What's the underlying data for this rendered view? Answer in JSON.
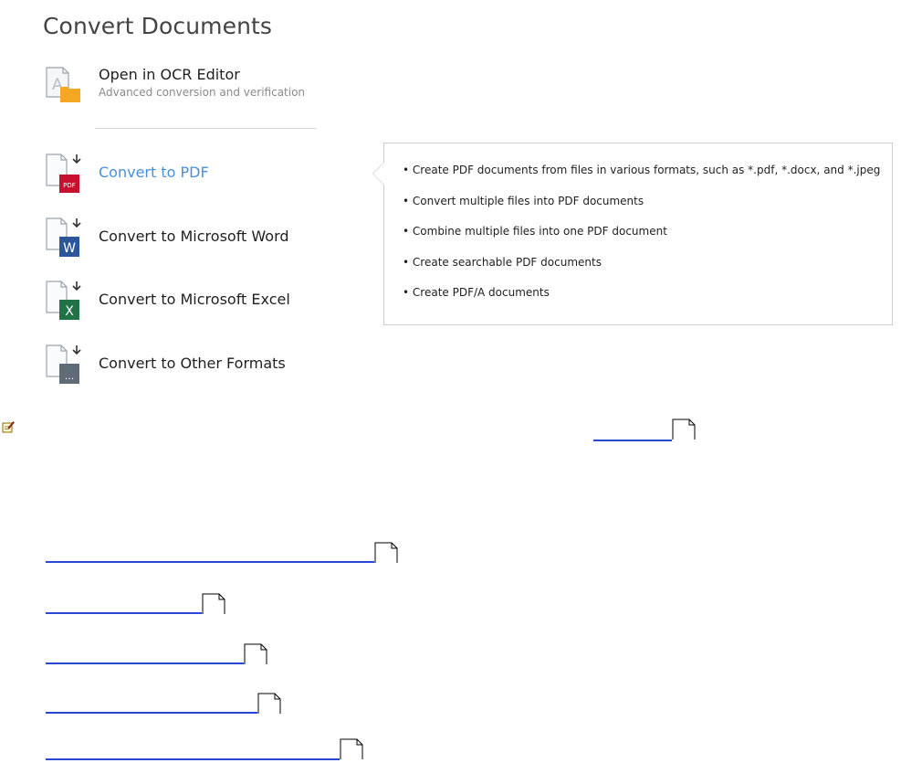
{
  "page": {
    "title": "Convert Documents"
  },
  "ocr": {
    "label": "Open in OCR Editor",
    "sublabel": "Advanced conversion and verification",
    "icon": "ocr-folder-icon"
  },
  "menu": [
    {
      "label": "Convert to PDF",
      "icon": "pdf-file-icon",
      "badge": "PDF",
      "active": true
    },
    {
      "label": "Convert to Microsoft Word",
      "icon": "word-file-icon",
      "badge": "W",
      "active": false
    },
    {
      "label": "Convert to Microsoft Excel",
      "icon": "excel-file-icon",
      "badge": "X",
      "active": false
    },
    {
      "label": "Convert to Other Formats",
      "icon": "other-file-icon",
      "badge": "...",
      "active": false
    }
  ],
  "tooltip": {
    "items": [
      "Create PDF documents from files in various formats, such as *.pdf, *.docx, and *.jpeg",
      "Convert multiple files into PDF documents",
      "Combine multiple files into one PDF document",
      "Create searchable PDF documents",
      "Create PDF/A documents"
    ]
  },
  "colors": {
    "accent": "#4a90d9",
    "link": "#2a46d4",
    "pdf_badge": "#c8102e",
    "word_badge": "#2b579a",
    "excel_badge": "#217346",
    "other_badge": "#5f6b77",
    "ocr_folder": "#f5a623"
  }
}
